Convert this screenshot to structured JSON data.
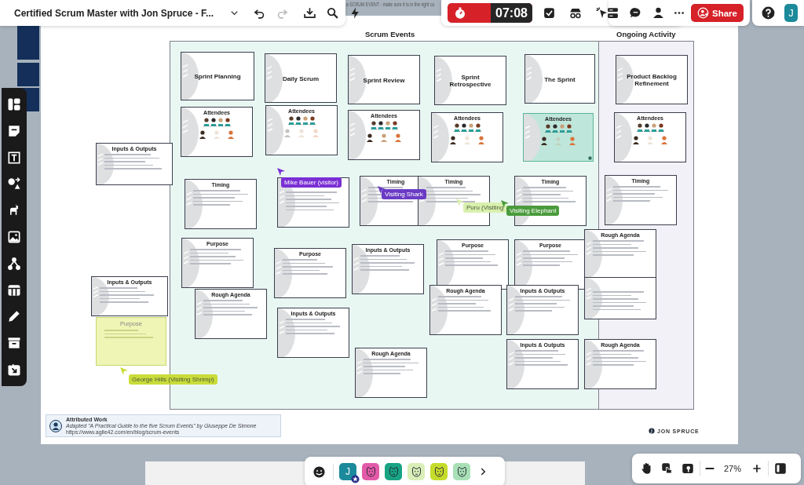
{
  "header": {
    "board_title": "Certified Scrum Master with Jon Spruce - F...",
    "canvas_note": "a SCRUM EVENT - make sure it is in the right co"
  },
  "timer": {
    "time": "07:08"
  },
  "share": {
    "label": "Share"
  },
  "user": {
    "initial": "J"
  },
  "board": {
    "sections": [
      {
        "title": "Scrum Events"
      },
      {
        "title": "Ongoing Activity"
      }
    ],
    "cards": [
      {
        "kind": "title",
        "title": "Sprint Planning"
      },
      {
        "kind": "title",
        "title": "Daily Scrum"
      },
      {
        "kind": "title",
        "title": "Sprint Review"
      },
      {
        "kind": "title",
        "title": "Sprint Retrospective"
      },
      {
        "kind": "title",
        "title": "The Sprint"
      },
      {
        "kind": "title",
        "title": "Product Backlog Refinement"
      },
      {
        "kind": "attendees",
        "title": "Attendees",
        "selected": false,
        "roles": [
          {
            "present": true
          },
          {
            "present": false
          },
          {
            "present": true
          }
        ]
      },
      {
        "kind": "attendees",
        "title": "Attendees",
        "selected": false,
        "roles": [
          {
            "present": false
          },
          {
            "present": false
          },
          {
            "present": false
          }
        ]
      },
      {
        "kind": "attendees",
        "title": "Attendees",
        "selected": false,
        "roles": [
          {
            "present": true
          },
          {
            "present": true
          },
          {
            "present": true
          }
        ]
      },
      {
        "kind": "attendees",
        "title": "Attendees",
        "selected": false,
        "roles": [
          {
            "present": true
          },
          {
            "present": false
          },
          {
            "present": true
          }
        ]
      },
      {
        "kind": "attendees",
        "title": "Attendees",
        "selected": true,
        "roles": [
          {
            "present": true
          },
          {
            "present": false
          },
          {
            "present": true
          }
        ]
      },
      {
        "kind": "attendees",
        "title": "Attendees",
        "selected": false,
        "roles": [
          {
            "present": true
          },
          {
            "present": false
          },
          {
            "present": true
          }
        ]
      },
      {
        "kind": "info",
        "title": "Inputs & Outputs"
      },
      {
        "kind": "info",
        "title": "Timing"
      },
      {
        "kind": "blank"
      },
      {
        "kind": "info",
        "title": "Timing"
      },
      {
        "kind": "info",
        "title": "Timing"
      },
      {
        "kind": "info",
        "title": "Timing"
      },
      {
        "kind": "info",
        "title": "Timing"
      },
      {
        "kind": "info",
        "title": "Purpose"
      },
      {
        "kind": "info",
        "title": "Purpose"
      },
      {
        "kind": "info",
        "title": "Inputs & Outputs"
      },
      {
        "kind": "info",
        "title": "Purpose"
      },
      {
        "kind": "info",
        "title": "Purpose"
      },
      {
        "kind": "info",
        "title": "Rough Agenda"
      },
      {
        "kind": "info",
        "title": "Inputs & Outputs"
      },
      {
        "kind": "info",
        "title": "Rough Agenda"
      },
      {
        "kind": "info",
        "title": "Rough Agenda"
      },
      {
        "kind": "info",
        "title": "Inputs & Outputs"
      },
      {
        "kind": "blank"
      },
      {
        "kind": "sticky",
        "title": "Purpose"
      },
      {
        "kind": "info",
        "title": "Inputs & Outputs"
      },
      {
        "kind": "info",
        "title": "Inputs & Outputs"
      },
      {
        "kind": "info",
        "title": "Rough Agenda"
      },
      {
        "kind": "info",
        "title": "Rough Agenda"
      }
    ]
  },
  "cursors": [
    {
      "name": "Mike Bauer (visitor)",
      "color": "#7a2fd4"
    },
    {
      "name": "Visiting Shark",
      "color": "#6a3bc4"
    },
    {
      "name": "Puru (Visiting",
      "color": "#d9f0ae"
    },
    {
      "name": "Visiting Elephant",
      "color": "#4a9b3c"
    },
    {
      "name": "George Hills (Visiting Shrimp)",
      "color": "#c9dc3a"
    }
  ],
  "attribution": {
    "title": "Attributed Work",
    "text": "Adapted \"A Practical Guide to the five Scrum Events\" by Giuseppe De Simone",
    "url": "https://www.agile42.com/en/blog/scrum-events"
  },
  "brand": "JON SPRUCE",
  "collaborators": [
    {
      "kind": "user",
      "initial": "J",
      "color": "#1b8a9b"
    },
    {
      "kind": "animal",
      "color": "#e25aa8"
    },
    {
      "kind": "animal",
      "color": "#18a383"
    },
    {
      "kind": "animal",
      "color": "#d8efb8"
    },
    {
      "kind": "animal",
      "color": "#c6dc2c"
    },
    {
      "kind": "animal",
      "color": "#a9e0b6"
    }
  ],
  "zoom": {
    "level_text": "27%"
  }
}
